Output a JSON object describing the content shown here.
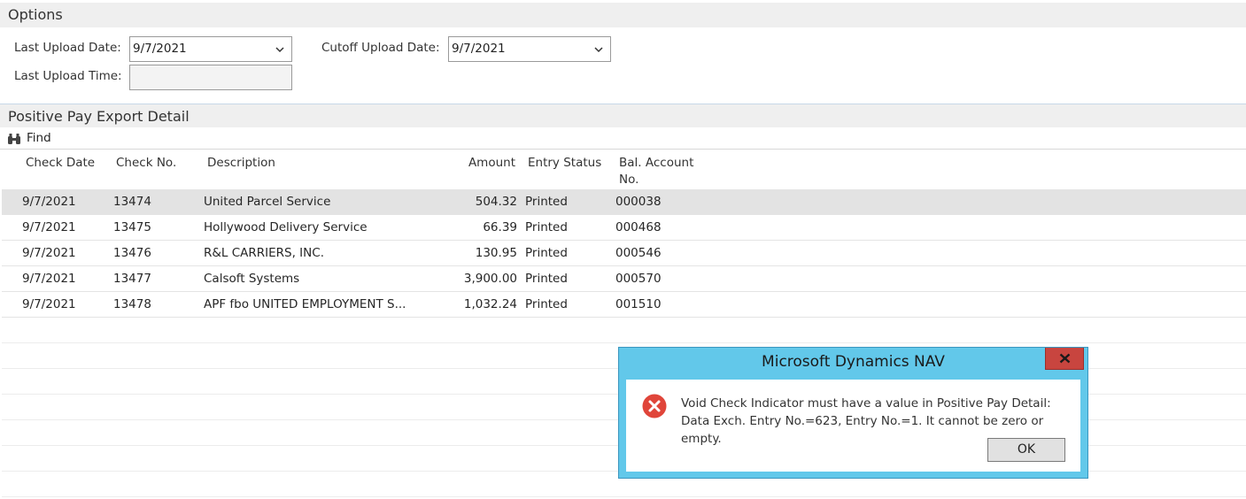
{
  "options": {
    "title": "Options",
    "last_upload_date_label": "Last Upload Date:",
    "last_upload_date_value": "9/7/2021",
    "cutoff_upload_date_label": "Cutoff Upload Date:",
    "cutoff_upload_date_value": "9/7/2021",
    "last_upload_time_label": "Last Upload Time:",
    "last_upload_time_value": ""
  },
  "detail": {
    "title": "Positive Pay Export Detail",
    "find_label": "Find",
    "columns": {
      "check_date": "Check Date",
      "check_no": "Check No.",
      "description": "Description",
      "amount": "Amount",
      "entry_status": "Entry Status",
      "bal_account_line1": "Bal. Account",
      "bal_account_line2": "No."
    },
    "rows": [
      {
        "check_date": "9/7/2021",
        "check_no": "13474",
        "description": "United Parcel Service",
        "amount": "504.32",
        "entry_status": "Printed",
        "bal_account": "000038"
      },
      {
        "check_date": "9/7/2021",
        "check_no": "13475",
        "description": "Hollywood Delivery Service",
        "amount": "66.39",
        "entry_status": "Printed",
        "bal_account": "000468"
      },
      {
        "check_date": "9/7/2021",
        "check_no": "13476",
        "description": "R&L CARRIERS, INC.",
        "amount": "130.95",
        "entry_status": "Printed",
        "bal_account": "000546"
      },
      {
        "check_date": "9/7/2021",
        "check_no": "13477",
        "description": "Calsoft Systems",
        "amount": "3,900.00",
        "entry_status": "Printed",
        "bal_account": "000570"
      },
      {
        "check_date": "9/7/2021",
        "check_no": "13478",
        "description": "APF fbo UNITED EMPLOYMENT S...",
        "amount": "1,032.24",
        "entry_status": "Printed",
        "bal_account": "001510"
      }
    ]
  },
  "dialog": {
    "title": "Microsoft Dynamics NAV",
    "message": "Void Check Indicator must have a value in Positive Pay Detail: Data Exch. Entry No.=623, Entry No.=1. It cannot be zero or empty.",
    "ok_label": "OK",
    "icon": "error-icon",
    "colors": {
      "title_bar": "#62c8ea",
      "close": "#c8453f",
      "error": "#e0453a"
    }
  }
}
